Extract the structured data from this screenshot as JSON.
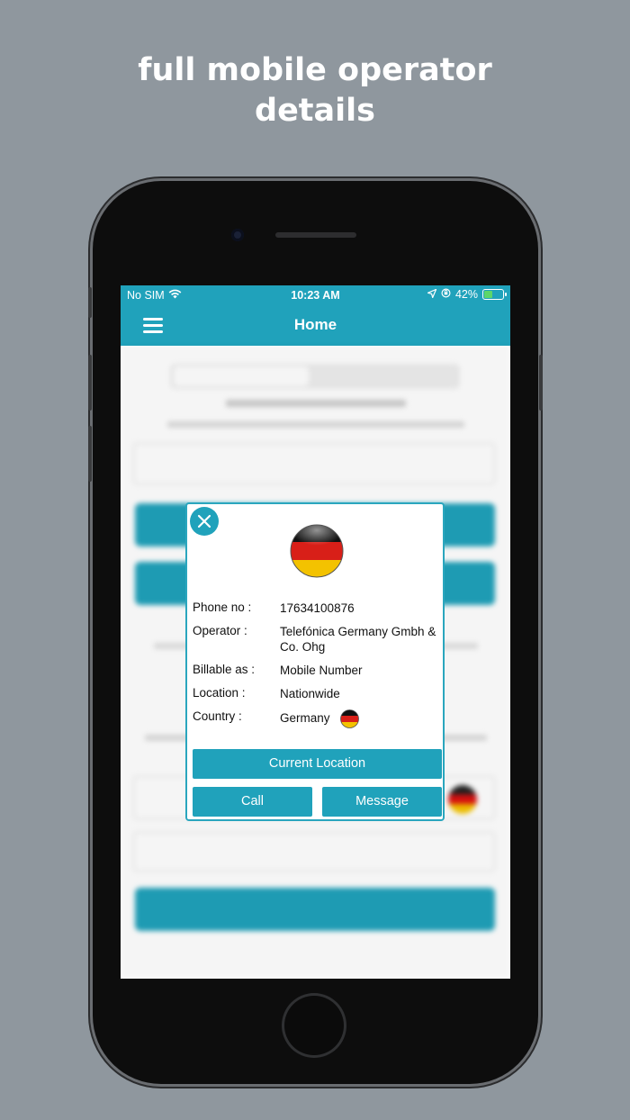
{
  "headline": {
    "line1": "full mobile operator",
    "line2": "details"
  },
  "status_bar": {
    "carrier": "No SIM",
    "time": "10:23 AM",
    "battery": "42%",
    "battery_level": 0.42,
    "wifi_icon": "wifi-icon",
    "location_icon": "location-arrow-icon",
    "lock_icon": "orientation-lock-icon"
  },
  "navbar": {
    "title": "Home",
    "menu_icon": "hamburger-menu-icon"
  },
  "popup": {
    "close_icon": "close-icon",
    "flag_icon": "germany-flag-icon",
    "rows": [
      {
        "label": "Phone no :",
        "value": "17634100876"
      },
      {
        "label": "Operator :",
        "value": "Telefónica Germany Gmbh & Co. Ohg"
      },
      {
        "label": "Billable as :",
        "value": "Mobile Number"
      },
      {
        "label": "Location :",
        "value": "Nationwide"
      },
      {
        "label": "Country :",
        "value": "Germany"
      }
    ],
    "current_location_label": "Current Location",
    "call_label": "Call",
    "message_label": "Message"
  },
  "colors": {
    "accent": "#20a2bb",
    "background": "#8f979e",
    "battery_fill": "#5cd66a"
  }
}
